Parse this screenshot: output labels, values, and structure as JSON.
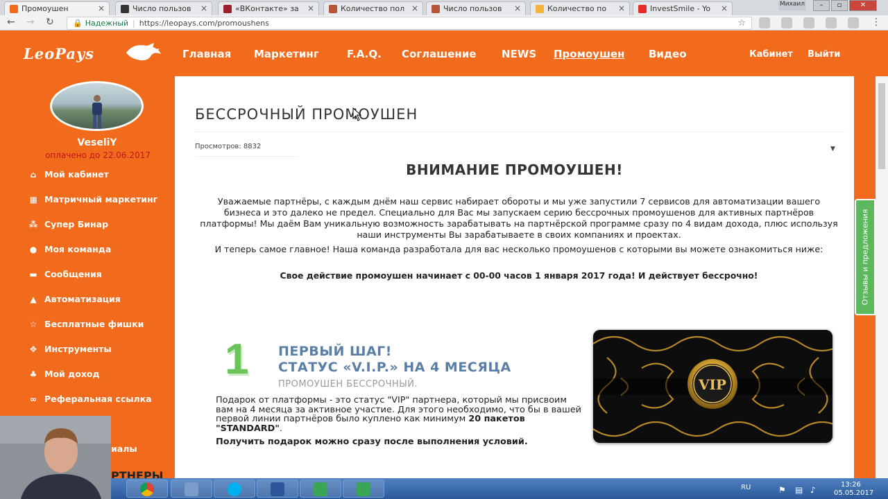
{
  "browser": {
    "tabs": [
      {
        "title": "Промоушен",
        "active": true
      },
      {
        "title": "Число пользов",
        "active": false
      },
      {
        "title": "«ВКонтакте» за",
        "active": false
      },
      {
        "title": "Количество пол",
        "active": false
      },
      {
        "title": "Число пользов",
        "active": false
      },
      {
        "title": "Количество по",
        "active": false
      },
      {
        "title": "InvestSmile - Yo",
        "active": false
      }
    ],
    "user_label": "Михаил",
    "secure_label": "Надежный",
    "url": "https://leopays.com/promoushens"
  },
  "site": {
    "logo": "LeoPays",
    "nav": [
      "Главная",
      "Маркетинг",
      "F.A.Q.",
      "Соглашение",
      "NEWS",
      "Промоушен",
      "Видео"
    ],
    "active_nav": "Промоушен",
    "cabinet": "Кабинет",
    "logout": "Выйти"
  },
  "sidebar": {
    "username": "VeseliY",
    "paid_until": "оплачено до 22.06.2017",
    "items": [
      {
        "label": "Мой кабинет",
        "icon": "home-icon"
      },
      {
        "label": "Матричный маркетинг",
        "icon": "grid-icon"
      },
      {
        "label": "Супер Бинар",
        "icon": "sitemap-icon"
      },
      {
        "label": "Моя команда",
        "icon": "user-icon"
      },
      {
        "label": "Сообщения",
        "icon": "chat-icon"
      },
      {
        "label": "Автоматизация",
        "icon": "graduation-icon"
      },
      {
        "label": "Бесплатные фишки",
        "icon": "star-icon"
      },
      {
        "label": "Инструменты",
        "icon": "tools-icon"
      },
      {
        "label": "Мой доход",
        "icon": "piggy-bank-icon"
      },
      {
        "label": "Реферальная ссылка",
        "icon": "link-icon"
      }
    ],
    "partial_item": "иалы",
    "partial_partners": "РТНЕРЫ"
  },
  "content": {
    "title": "БЕССРОЧНЫЙ ПРОМОУШЕН",
    "views": "Просмотров: 8832",
    "attention": "ВНИМАНИЕ ПРОМОУШЕН!",
    "para1": "Уважаемые партнёры, с каждым днём наш сервис набирает обороты и мы уже запустили 7 сервисов для автоматизации вашего бизнеса и это далеко не предел. Специально для Вас мы запускаем серию бессрочных промоушенов для активных партнёров платформы! Мы даём Вам уникальную возможность зарабатывать на партнёрской программе сразу по 4 видам дохода, плюс используя наши инструменты Вы зарабатываете в своих компаниях и проектах.",
    "para2": "И теперь самое главное! Наша команда разработала для вас несколько промоушенов с которыми вы можете ознакомиться ниже:",
    "para3": "Свое действие промоушен начинает с 00-00 часов 1 января 2017 года! И действует бессрочно!",
    "step": {
      "number": "1",
      "heading1": "ПЕРВЫЙ ШАГ!",
      "heading2": "СТАТУС «V.I.P.» НА 4 МЕСЯЦА",
      "sub": "ПРОМОУШЕН БЕССРОЧНЫЙ.",
      "text": "Подарок от платформы - это статус \"VIP\" партнера, который мы присвоим вам на 4 месяца за активное участие. Для этого необходимо, что бы в вашей первой линии партнёров было куплено как минимум",
      "text_bold": "20 пакетов \"STANDARD\"",
      "text_end": ".",
      "cta": "Получить подарок можно сразу после выполнения условий.",
      "card_label": "VIP"
    }
  },
  "feedback_tab": "Отзывы и предложения",
  "taskbar": {
    "lang": "RU",
    "time": "13:26",
    "date": "05.05.2017"
  },
  "colors": {
    "brand_orange": "#f26a1b",
    "paid_red": "#c0151a",
    "step_green": "#6cc35b",
    "step_blue": "#5a7ea6",
    "feedback_green": "#5cb85c"
  }
}
